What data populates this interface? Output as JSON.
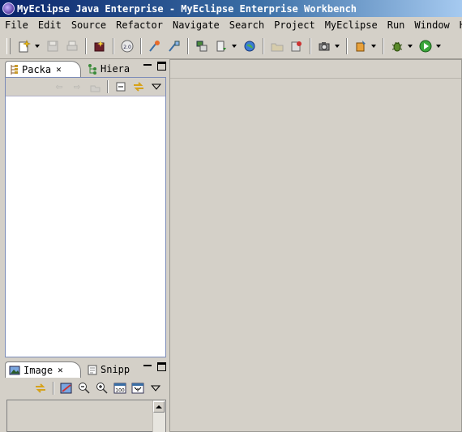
{
  "window": {
    "title": "MyEclipse Java Enterprise - MyEclipse Enterprise Workbench"
  },
  "menu": {
    "items": [
      "File",
      "Edit",
      "Source",
      "Refactor",
      "Navigate",
      "Search",
      "Project",
      "MyEclipse",
      "Run",
      "Window",
      "Help"
    ]
  },
  "toolbar": {
    "icons": [
      "new-icon",
      "save-icon",
      "print-icon",
      "deploy-icon",
      "j2ee-version-icon",
      "new-wizard-icon",
      "open-type-icon",
      "open-perspective-icon",
      "web-browser-icon",
      "open-folder-icon",
      "refresh-icon",
      "camera-icon",
      "external-tools-icon",
      "debug-icon",
      "run-icon"
    ]
  },
  "top_panel": {
    "tabs": [
      {
        "label": "Packa",
        "icon": "package-explorer-icon",
        "active": true
      },
      {
        "label": "Hiera",
        "icon": "hierarchy-icon",
        "active": false
      }
    ]
  },
  "bottom_panel": {
    "tabs": [
      {
        "label": "Image",
        "icon": "image-icon",
        "active": true
      },
      {
        "label": "Snipp",
        "icon": "snippets-icon",
        "active": false
      }
    ]
  },
  "colors": {
    "titlebar_start": "#0a246a",
    "titlebar_end": "#a6caf0",
    "chrome": "#d4d0c8",
    "view_background": "#ffffff"
  }
}
